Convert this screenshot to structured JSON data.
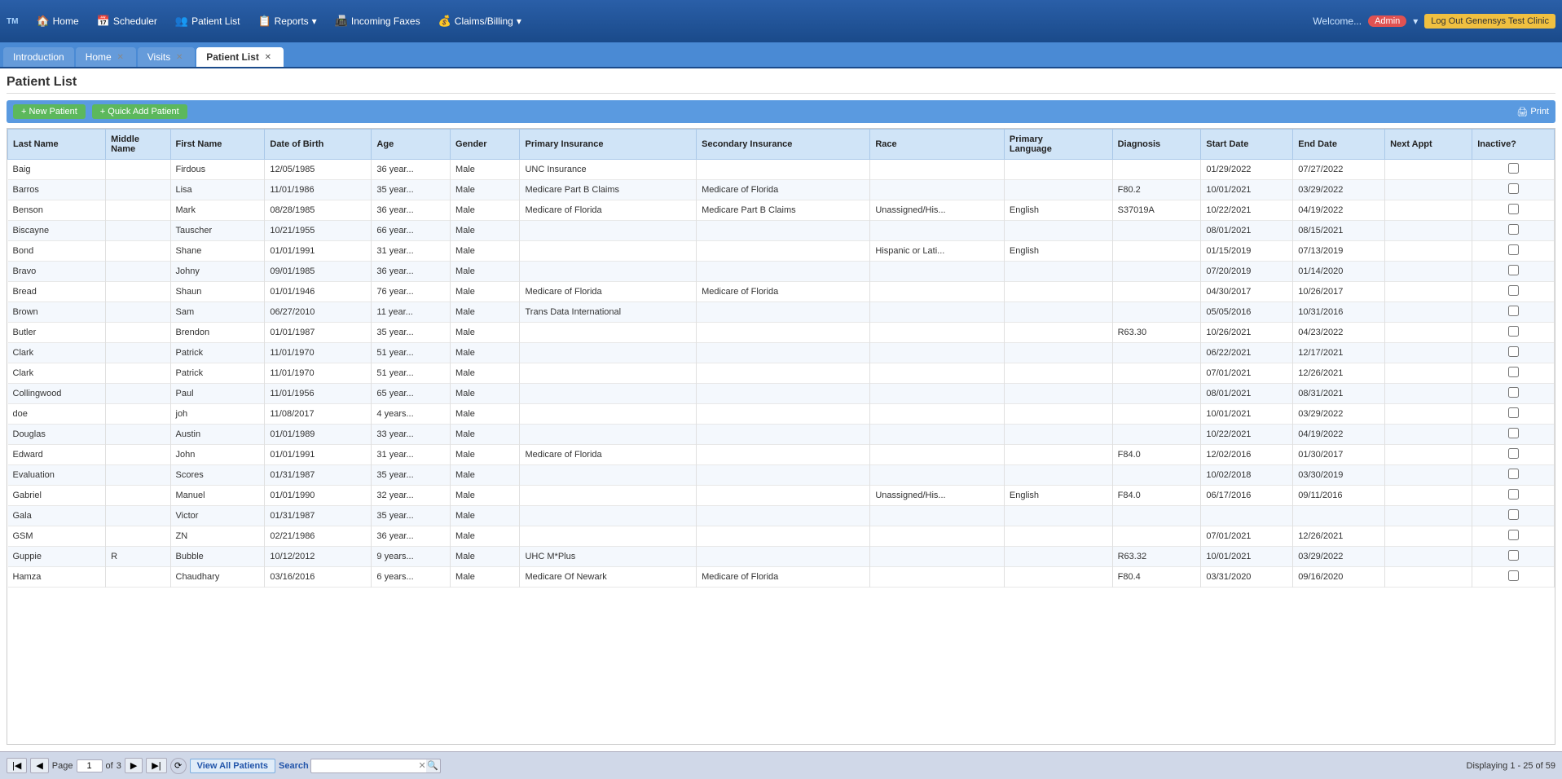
{
  "app": {
    "logo": "TM",
    "welcome": "Welcome..."
  },
  "topnav": {
    "items": [
      {
        "label": "Home",
        "icon": "🏠",
        "id": "home"
      },
      {
        "label": "Scheduler",
        "icon": "📅",
        "id": "scheduler"
      },
      {
        "label": "Patient List",
        "icon": "👥",
        "id": "patient-list"
      },
      {
        "label": "Reports",
        "icon": "📋",
        "id": "reports",
        "hasArrow": true
      },
      {
        "label": "Incoming Faxes",
        "icon": "📠",
        "id": "incoming-faxes"
      },
      {
        "label": "Claims/Billing",
        "icon": "💰",
        "id": "claims-billing",
        "hasArrow": true
      }
    ],
    "admin_label": "Admin",
    "logout_label": "Log Out Genensys Test Clinic"
  },
  "tabs": [
    {
      "label": "Introduction",
      "id": "introduction",
      "active": false,
      "closable": false
    },
    {
      "label": "Home",
      "id": "home",
      "active": false,
      "closable": true
    },
    {
      "label": "Visits",
      "id": "visits",
      "active": false,
      "closable": true
    },
    {
      "label": "Patient List",
      "id": "patient-list",
      "active": true,
      "closable": true
    }
  ],
  "page": {
    "title": "Patient List",
    "new_patient_btn": "+ New Patient",
    "quick_add_btn": "+ Quick Add Patient",
    "print_btn": "Print"
  },
  "table": {
    "columns": [
      {
        "label": "Last Name",
        "key": "last_name"
      },
      {
        "label": "Middle Name",
        "key": "middle_name"
      },
      {
        "label": "First Name",
        "key": "first_name"
      },
      {
        "label": "Date of Birth",
        "key": "dob"
      },
      {
        "label": "Age",
        "key": "age"
      },
      {
        "label": "Gender",
        "key": "gender"
      },
      {
        "label": "Primary Insurance",
        "key": "primary_insurance"
      },
      {
        "label": "Secondary Insurance",
        "key": "secondary_insurance"
      },
      {
        "label": "Race",
        "key": "race"
      },
      {
        "label": "Primary Language",
        "key": "primary_language"
      },
      {
        "label": "Diagnosis",
        "key": "diagnosis"
      },
      {
        "label": "Start Date",
        "key": "start_date"
      },
      {
        "label": "End Date",
        "key": "end_date"
      },
      {
        "label": "Next Appt",
        "key": "next_appt"
      },
      {
        "label": "Inactive?",
        "key": "inactive"
      }
    ],
    "rows": [
      {
        "last_name": "Baig",
        "middle_name": "",
        "first_name": "Firdous",
        "dob": "12/05/1985",
        "age": "36 year...",
        "gender": "Male",
        "primary_insurance": "UNC Insurance",
        "secondary_insurance": "",
        "race": "",
        "primary_language": "",
        "diagnosis": "",
        "start_date": "01/29/2022",
        "end_date": "07/27/2022",
        "next_appt": "",
        "inactive": false
      },
      {
        "last_name": "Barros",
        "middle_name": "",
        "first_name": "Lisa",
        "dob": "11/01/1986",
        "age": "35 year...",
        "gender": "Male",
        "primary_insurance": "Medicare Part B Claims",
        "secondary_insurance": "Medicare of Florida",
        "race": "",
        "primary_language": "",
        "diagnosis": "F80.2",
        "start_date": "10/01/2021",
        "end_date": "03/29/2022",
        "next_appt": "",
        "inactive": false
      },
      {
        "last_name": "Benson",
        "middle_name": "",
        "first_name": "Mark",
        "dob": "08/28/1985",
        "age": "36 year...",
        "gender": "Male",
        "primary_insurance": "Medicare of Florida",
        "secondary_insurance": "Medicare Part B Claims",
        "race": "Unassigned/His...",
        "primary_language": "English",
        "diagnosis": "S37019A",
        "start_date": "10/22/2021",
        "end_date": "04/19/2022",
        "next_appt": "",
        "inactive": false
      },
      {
        "last_name": "Biscayne",
        "middle_name": "",
        "first_name": "Tauscher",
        "dob": "10/21/1955",
        "age": "66 year...",
        "gender": "Male",
        "primary_insurance": "",
        "secondary_insurance": "",
        "race": "",
        "primary_language": "",
        "diagnosis": "",
        "start_date": "08/01/2021",
        "end_date": "08/15/2021",
        "next_appt": "",
        "inactive": false
      },
      {
        "last_name": "Bond",
        "middle_name": "",
        "first_name": "Shane",
        "dob": "01/01/1991",
        "age": "31 year...",
        "gender": "Male",
        "primary_insurance": "",
        "secondary_insurance": "",
        "race": "Hispanic or Lati...",
        "primary_language": "English",
        "diagnosis": "",
        "start_date": "01/15/2019",
        "end_date": "07/13/2019",
        "next_appt": "",
        "inactive": false
      },
      {
        "last_name": "Bravo",
        "middle_name": "",
        "first_name": "Johny",
        "dob": "09/01/1985",
        "age": "36 year...",
        "gender": "Male",
        "primary_insurance": "",
        "secondary_insurance": "",
        "race": "",
        "primary_language": "",
        "diagnosis": "",
        "start_date": "07/20/2019",
        "end_date": "01/14/2020",
        "next_appt": "",
        "inactive": false
      },
      {
        "last_name": "Bread",
        "middle_name": "",
        "first_name": "Shaun",
        "dob": "01/01/1946",
        "age": "76 year...",
        "gender": "Male",
        "primary_insurance": "Medicare of Florida",
        "secondary_insurance": "Medicare of Florida",
        "race": "",
        "primary_language": "",
        "diagnosis": "",
        "start_date": "04/30/2017",
        "end_date": "10/26/2017",
        "next_appt": "",
        "inactive": false
      },
      {
        "last_name": "Brown",
        "middle_name": "",
        "first_name": "Sam",
        "dob": "06/27/2010",
        "age": "11 year...",
        "gender": "Male",
        "primary_insurance": "Trans Data International",
        "secondary_insurance": "",
        "race": "",
        "primary_language": "",
        "diagnosis": "",
        "start_date": "05/05/2016",
        "end_date": "10/31/2016",
        "next_appt": "",
        "inactive": false
      },
      {
        "last_name": "Butler",
        "middle_name": "",
        "first_name": "Brendon",
        "dob": "01/01/1987",
        "age": "35 year...",
        "gender": "Male",
        "primary_insurance": "",
        "secondary_insurance": "",
        "race": "",
        "primary_language": "",
        "diagnosis": "R63.30",
        "start_date": "10/26/2021",
        "end_date": "04/23/2022",
        "next_appt": "",
        "inactive": false
      },
      {
        "last_name": "Clark",
        "middle_name": "",
        "first_name": "Patrick",
        "dob": "11/01/1970",
        "age": "51 year...",
        "gender": "Male",
        "primary_insurance": "",
        "secondary_insurance": "",
        "race": "",
        "primary_language": "",
        "diagnosis": "",
        "start_date": "06/22/2021",
        "end_date": "12/17/2021",
        "next_appt": "",
        "inactive": false
      },
      {
        "last_name": "Clark",
        "middle_name": "",
        "first_name": "Patrick",
        "dob": "11/01/1970",
        "age": "51 year...",
        "gender": "Male",
        "primary_insurance": "",
        "secondary_insurance": "",
        "race": "",
        "primary_language": "",
        "diagnosis": "",
        "start_date": "07/01/2021",
        "end_date": "12/26/2021",
        "next_appt": "",
        "inactive": false
      },
      {
        "last_name": "Collingwood",
        "middle_name": "",
        "first_name": "Paul",
        "dob": "11/01/1956",
        "age": "65 year...",
        "gender": "Male",
        "primary_insurance": "",
        "secondary_insurance": "",
        "race": "",
        "primary_language": "",
        "diagnosis": "",
        "start_date": "08/01/2021",
        "end_date": "08/31/2021",
        "next_appt": "",
        "inactive": false
      },
      {
        "last_name": "doe",
        "middle_name": "",
        "first_name": "joh",
        "dob": "11/08/2017",
        "age": "4 years...",
        "gender": "Male",
        "primary_insurance": "",
        "secondary_insurance": "",
        "race": "",
        "primary_language": "",
        "diagnosis": "",
        "start_date": "10/01/2021",
        "end_date": "03/29/2022",
        "next_appt": "",
        "inactive": false
      },
      {
        "last_name": "Douglas",
        "middle_name": "",
        "first_name": "Austin",
        "dob": "01/01/1989",
        "age": "33 year...",
        "gender": "Male",
        "primary_insurance": "",
        "secondary_insurance": "",
        "race": "",
        "primary_language": "",
        "diagnosis": "",
        "start_date": "10/22/2021",
        "end_date": "04/19/2022",
        "next_appt": "",
        "inactive": false
      },
      {
        "last_name": "Edward",
        "middle_name": "",
        "first_name": "John",
        "dob": "01/01/1991",
        "age": "31 year...",
        "gender": "Male",
        "primary_insurance": "Medicare of Florida",
        "secondary_insurance": "",
        "race": "",
        "primary_language": "",
        "diagnosis": "F84.0",
        "start_date": "12/02/2016",
        "end_date": "01/30/2017",
        "next_appt": "",
        "inactive": false
      },
      {
        "last_name": "Evaluation",
        "middle_name": "",
        "first_name": "Scores",
        "dob": "01/31/1987",
        "age": "35 year...",
        "gender": "Male",
        "primary_insurance": "",
        "secondary_insurance": "",
        "race": "",
        "primary_language": "",
        "diagnosis": "",
        "start_date": "10/02/2018",
        "end_date": "03/30/2019",
        "next_appt": "",
        "inactive": false
      },
      {
        "last_name": "Gabriel",
        "middle_name": "",
        "first_name": "Manuel",
        "dob": "01/01/1990",
        "age": "32 year...",
        "gender": "Male",
        "primary_insurance": "",
        "secondary_insurance": "",
        "race": "Unassigned/His...",
        "primary_language": "English",
        "diagnosis": "F84.0",
        "start_date": "06/17/2016",
        "end_date": "09/11/2016",
        "next_appt": "",
        "inactive": false
      },
      {
        "last_name": "Gala",
        "middle_name": "",
        "first_name": "Victor",
        "dob": "01/31/1987",
        "age": "35 year...",
        "gender": "Male",
        "primary_insurance": "",
        "secondary_insurance": "",
        "race": "",
        "primary_language": "",
        "diagnosis": "",
        "start_date": "",
        "end_date": "",
        "next_appt": "",
        "inactive": false
      },
      {
        "last_name": "GSM",
        "middle_name": "",
        "first_name": "ZN",
        "dob": "02/21/1986",
        "age": "36 year...",
        "gender": "Male",
        "primary_insurance": "",
        "secondary_insurance": "",
        "race": "",
        "primary_language": "",
        "diagnosis": "",
        "start_date": "07/01/2021",
        "end_date": "12/26/2021",
        "next_appt": "",
        "inactive": false
      },
      {
        "last_name": "Guppie",
        "middle_name": "R",
        "first_name": "Bubble",
        "dob": "10/12/2012",
        "age": "9 years...",
        "gender": "Male",
        "primary_insurance": "UHC M*Plus",
        "secondary_insurance": "",
        "race": "",
        "primary_language": "",
        "diagnosis": "R63.32",
        "start_date": "10/01/2021",
        "end_date": "03/29/2022",
        "next_appt": "",
        "inactive": false
      },
      {
        "last_name": "Hamza",
        "middle_name": "",
        "first_name": "Chaudhary",
        "dob": "03/16/2016",
        "age": "6 years...",
        "gender": "Male",
        "primary_insurance": "Medicare Of Newark",
        "secondary_insurance": "Medicare of Florida",
        "race": "",
        "primary_language": "",
        "diagnosis": "F80.4",
        "start_date": "03/31/2020",
        "end_date": "09/16/2020",
        "next_appt": "",
        "inactive": false
      }
    ]
  },
  "pagination": {
    "current_page": 1,
    "total_pages": 3,
    "view_all_label": "View All Patients",
    "search_label": "Search",
    "search_placeholder": "",
    "display_info": "Displaying 1 - 25 of 59"
  }
}
